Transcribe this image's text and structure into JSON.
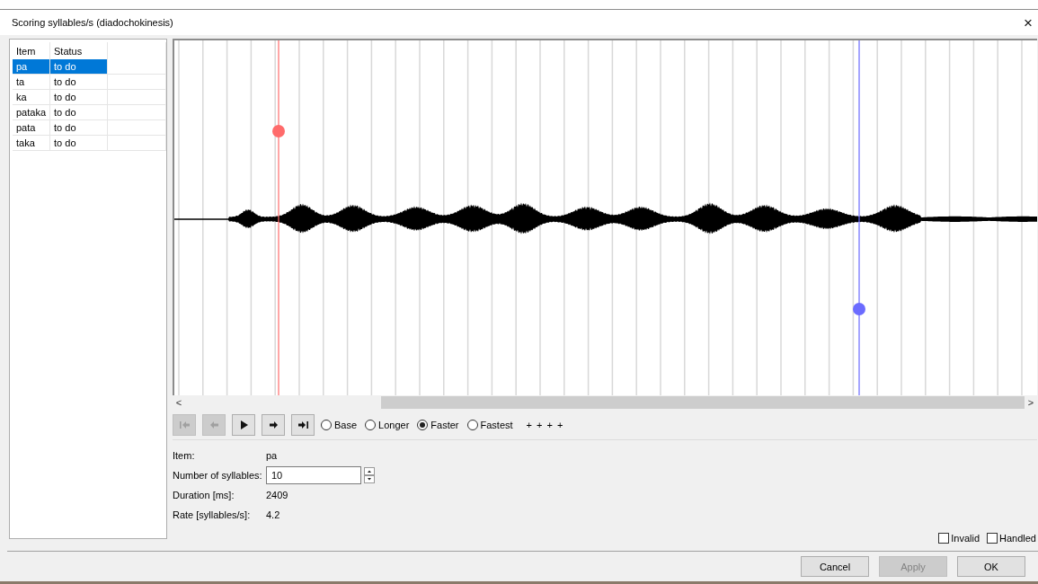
{
  "window": {
    "title": "Scoring syllables/s (diadochokinesis)",
    "close": "×"
  },
  "table": {
    "columns": [
      "Item",
      "Status"
    ],
    "rows": [
      {
        "item": "pa",
        "status": "to do",
        "selected": true
      },
      {
        "item": "ta",
        "status": "to do",
        "selected": false
      },
      {
        "item": "ka",
        "status": "to do",
        "selected": false
      },
      {
        "item": "pataka",
        "status": "to do",
        "selected": false
      },
      {
        "item": "pata",
        "status": "to do",
        "selected": false
      },
      {
        "item": "taka",
        "status": "to do",
        "selected": false
      }
    ]
  },
  "waveform": {
    "markers": [
      {
        "color": "#ff6b6b"
      },
      {
        "color": "#6b6bff"
      }
    ]
  },
  "scrollbar": {
    "left": "<",
    "right": ">"
  },
  "transport": [
    {
      "kind": "first",
      "disabled": true
    },
    {
      "kind": "prev",
      "disabled": true
    },
    {
      "kind": "play",
      "disabled": false
    },
    {
      "kind": "next",
      "disabled": false
    },
    {
      "kind": "last",
      "disabled": false
    }
  ],
  "speeds": [
    {
      "label": "Base",
      "selected": false
    },
    {
      "label": "Longer",
      "selected": false
    },
    {
      "label": "Faster",
      "selected": true
    },
    {
      "label": "Fastest",
      "selected": false
    }
  ],
  "marks": "+ + + +",
  "info": [
    {
      "label": "Item:",
      "value": "pa",
      "kind": "text"
    },
    {
      "label": "Number of syllables:",
      "value": "10",
      "kind": "spin"
    },
    {
      "label": "Duration [ms]:",
      "value": "2409",
      "kind": "text"
    },
    {
      "label": "Rate [syllables/s]:",
      "value": "4.2",
      "kind": "text"
    }
  ],
  "flags": [
    {
      "label": "Invalid",
      "checked": false
    },
    {
      "label": "Handled",
      "checked": false
    }
  ],
  "buttons": [
    {
      "label": "Cancel",
      "disabled": false
    },
    {
      "label": "Apply",
      "disabled": true
    },
    {
      "label": "OK",
      "disabled": false
    }
  ]
}
